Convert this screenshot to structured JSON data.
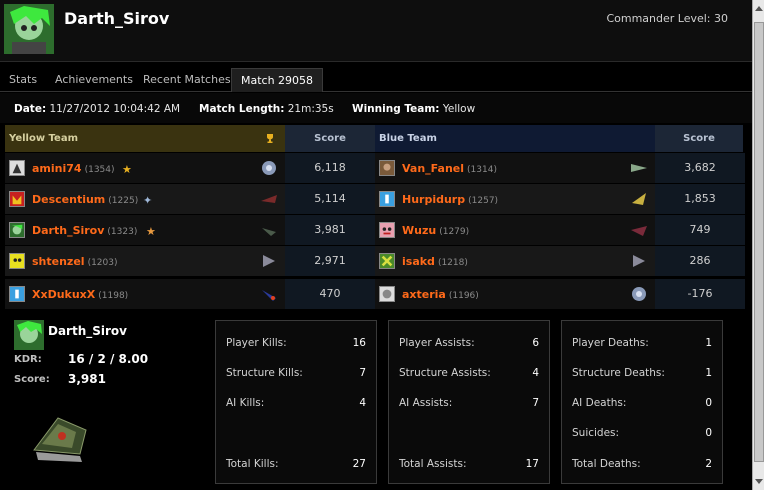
{
  "player": {
    "name": "Darth_Sirov",
    "commander_level_text": "Commander Level: 30"
  },
  "tabs": [
    {
      "label": "Stats"
    },
    {
      "label": "Achievements"
    },
    {
      "label": "Recent Matches"
    },
    {
      "label": "Match 29058",
      "active": true
    }
  ],
  "match": {
    "date_label": "Date:",
    "date_value": "11/27/2012 10:04:42 AM",
    "length_label": "Match Length:",
    "length_value": "21m:35s",
    "winner_label": "Winning Team:",
    "winner_value": "Yellow"
  },
  "yellow_team": {
    "header": "Yellow Team",
    "score_header": "Score",
    "players": [
      {
        "name": "amini74",
        "rating": "(1354)",
        "score": "6,118",
        "badge": "★"
      },
      {
        "name": "Descentium",
        "rating": "(1225)",
        "score": "5,114",
        "badge": "✦"
      },
      {
        "name": "Darth_Sirov",
        "rating": "(1323)",
        "score": "3,981",
        "badge": "★"
      },
      {
        "name": "shtenzel",
        "rating": "(1203)",
        "score": "2,971",
        "badge": ""
      },
      {
        "name": "XxDukuxX",
        "rating": "(1198)",
        "score": "470",
        "badge": ""
      }
    ]
  },
  "blue_team": {
    "header": "Blue Team",
    "score_header": "Score",
    "players": [
      {
        "name": "Van_Fanel",
        "rating": "(1314)",
        "score": "3,682"
      },
      {
        "name": "Hurpidurp",
        "rating": "(1257)",
        "score": "1,853"
      },
      {
        "name": "Wuzu",
        "rating": "(1279)",
        "score": "749"
      },
      {
        "name": "isakd",
        "rating": "(1218)",
        "score": "286"
      },
      {
        "name": "axteria",
        "rating": "(1196)",
        "score": "-176"
      }
    ]
  },
  "summary": {
    "name": "Darth_Sirov",
    "kdr_label": "KDR:",
    "kdr_value": "16 / 2 / 8.00",
    "score_label": "Score:",
    "score_value": "3,981"
  },
  "kills": [
    {
      "label": "Player Kills:",
      "value": "16"
    },
    {
      "label": "Structure Kills:",
      "value": "7"
    },
    {
      "label": "AI Kills:",
      "value": "4"
    },
    {
      "label": "Total Kills:",
      "value": "27"
    }
  ],
  "assists": [
    {
      "label": "Player Assists:",
      "value": "6"
    },
    {
      "label": "Structure Assists:",
      "value": "4"
    },
    {
      "label": "AI Assists:",
      "value": "7"
    },
    {
      "label": "Total Assists:",
      "value": "17"
    }
  ],
  "deaths": [
    {
      "label": "Player Deaths:",
      "value": "1"
    },
    {
      "label": "Structure Deaths:",
      "value": "1"
    },
    {
      "label": "AI Deaths:",
      "value": "0"
    },
    {
      "label": "Suicides:",
      "value": "0"
    },
    {
      "label": "Total Deaths:",
      "value": "2"
    }
  ],
  "colors": {
    "player_name": "#ff6a1a",
    "yellow_header": "#3a3310",
    "blue_header": "#0f1a33"
  }
}
